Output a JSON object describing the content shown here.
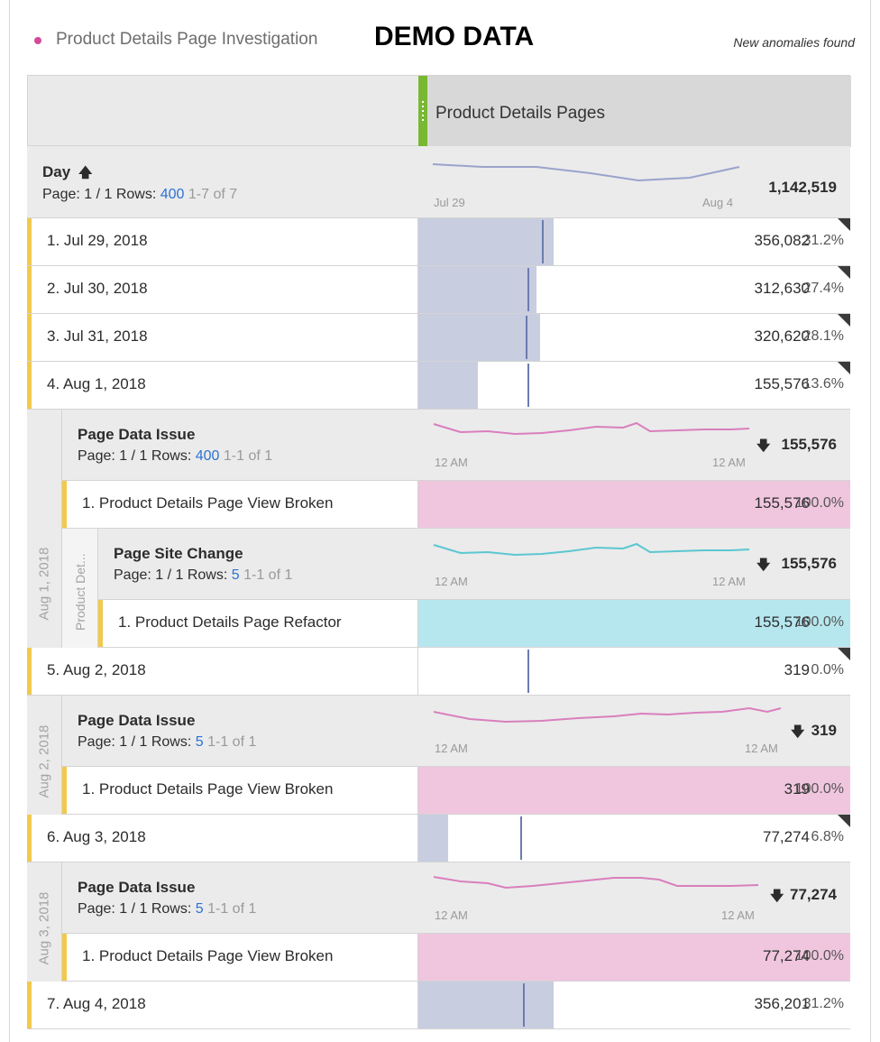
{
  "project": {
    "title": "Product Details Page Investigation",
    "demo_label": "DEMO DATA",
    "anomalies_label": "New anomalies found",
    "dot_color": "#d44a9a"
  },
  "table": {
    "column_header": "Product Details Pages",
    "dimension": {
      "name": "Day",
      "sort_icon": "arrow-up-icon",
      "page_label": "Page: 1 / 1",
      "rows_label": "Rows:",
      "rows_value": "400",
      "range": "1-7 of 7",
      "tick_start": "Jul 29",
      "tick_end": "Aug 4",
      "total": "1,142,519"
    },
    "rows": [
      {
        "label": "1.  Jul 29, 2018",
        "value": "356,082",
        "pct": "31.2%",
        "share": 0.312
      },
      {
        "label": "2.  Jul 30, 2018",
        "value": "312,630",
        "pct": "27.4%",
        "share": 0.274
      },
      {
        "label": "3.  Jul 31, 2018",
        "value": "320,620",
        "pct": "28.1%",
        "share": 0.281
      },
      {
        "label": "4.  Aug 1, 2018",
        "value": "155,576",
        "pct": "13.6%",
        "share": 0.136
      },
      {
        "label": "5.  Aug 2, 2018",
        "value": "319",
        "pct": "0.0%",
        "share": 0.0
      },
      {
        "label": "6.  Aug 3, 2018",
        "value": "77,274",
        "pct": "6.8%",
        "share": 0.068
      },
      {
        "label": "7.  Aug 4, 2018",
        "value": "356,201",
        "pct": "31.2%",
        "share": 0.312
      }
    ],
    "breakdowns": {
      "aug1": {
        "side_label": "Aug 1, 2018",
        "inner_side_label": "Product Det...",
        "data_issue": {
          "title": "Page Data Issue",
          "page_label": "Page: 1 / 1",
          "rows_label": "Rows:",
          "rows_value": "400",
          "range": "1-1 of 1",
          "tick_start": "12 AM",
          "tick_end": "12 AM",
          "total": "155,576",
          "item_label": "1.   Product Details Page View Broken",
          "item_value": "155,576",
          "item_pct": "100.0%"
        },
        "site_change": {
          "title": "Page Site Change",
          "page_label": "Page: 1 / 1",
          "rows_label": "Rows:",
          "rows_value": "5",
          "range": "1-1 of 1",
          "tick_start": "12 AM",
          "tick_end": "12 AM",
          "total": "155,576",
          "item_label": "1.   Product Details Page Refactor",
          "item_value": "155,576",
          "item_pct": "100.0%"
        }
      },
      "aug2": {
        "side_label": "Aug 2, 2018",
        "title": "Page Data Issue",
        "page_label": "Page: 1 / 1",
        "rows_label": "Rows:",
        "rows_value": "5",
        "range": "1-1 of 1",
        "tick_start": "12 AM",
        "tick_end": "12 AM",
        "total": "319",
        "item_label": "1.   Product Details Page View Broken",
        "item_value": "319",
        "item_pct": "100.0%"
      },
      "aug3": {
        "side_label": "Aug 3, 2018",
        "title": "Page Data Issue",
        "page_label": "Page: 1 / 1",
        "rows_label": "Rows:",
        "rows_value": "5",
        "range": "1-1 of 1",
        "tick_start": "12 AM",
        "tick_end": "12 AM",
        "total": "77,274",
        "item_label": "1.   Product Details Page View Broken",
        "item_value": "77,274",
        "item_pct": "100.0%"
      }
    },
    "colors": {
      "accent": "#f2c94c",
      "column_accent": "#78b833",
      "bar": "#c8cde0",
      "trend_line": "#9aa3cc",
      "pink_fill": "#f0c6df",
      "pink_line": "#d97fbd",
      "cyan_fill": "#b6e7ee",
      "cyan_line": "#5bc7d1"
    }
  }
}
